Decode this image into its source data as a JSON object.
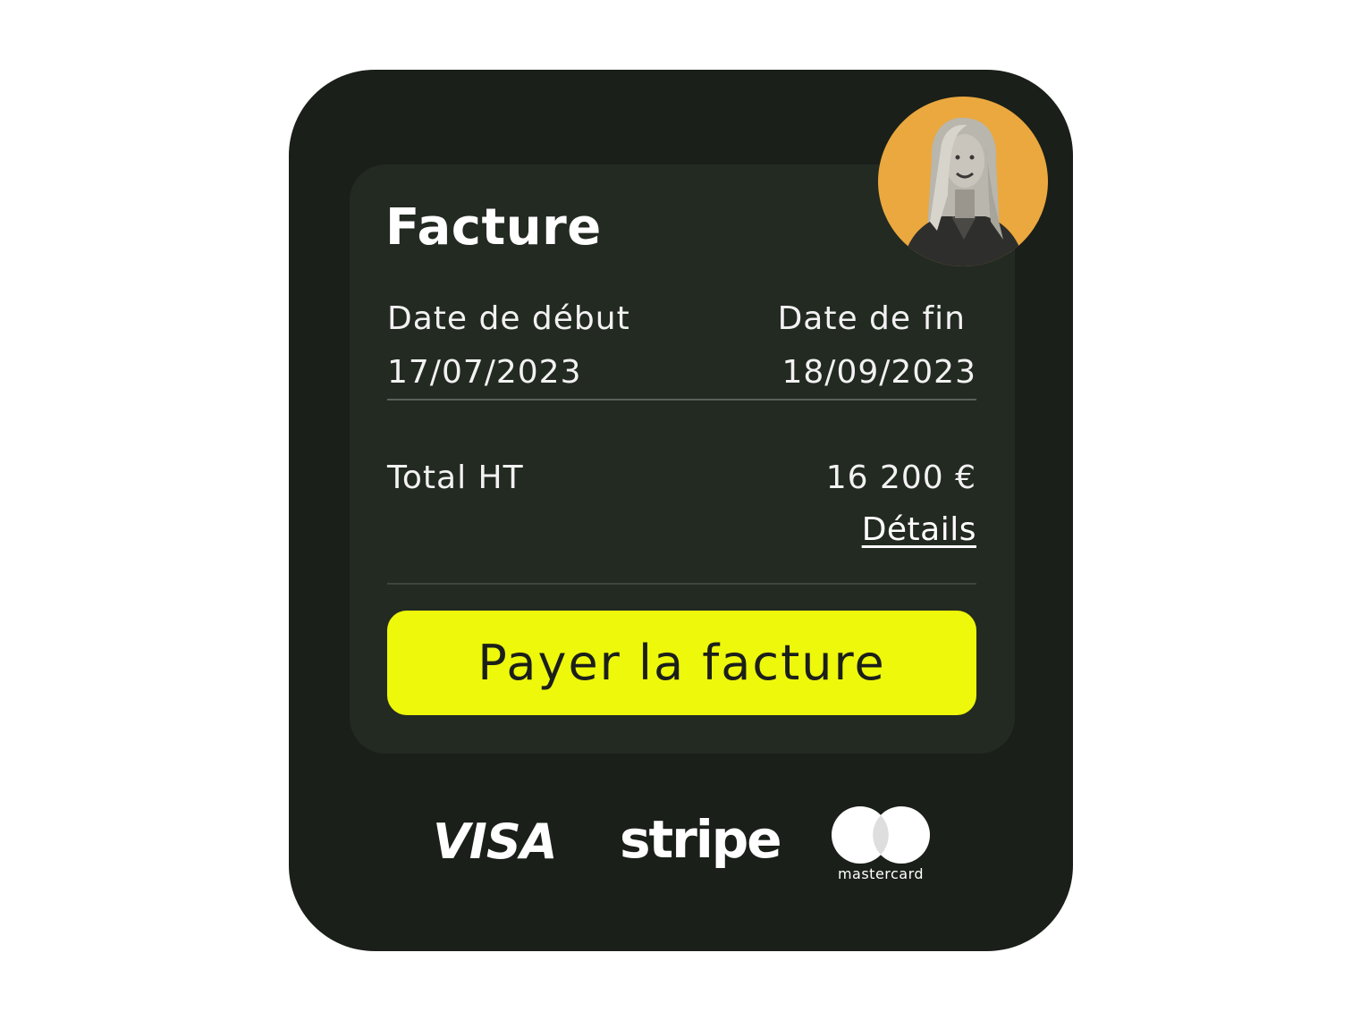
{
  "invoice": {
    "title": "Facture",
    "start_label": "Date de début",
    "start_value": "17/07/2023",
    "end_label": "Date de fin",
    "end_value": "18/09/2023",
    "total_label": "Total HT",
    "total_value": "16 200 €",
    "details_link": "Détails",
    "pay_button": "Payer la facture"
  },
  "payment_logos": {
    "visa": "VISA",
    "stripe": "stripe",
    "mastercard": "mastercard"
  },
  "colors": {
    "card_background": "#1a1f19",
    "panel_background": "#232a22",
    "accent_button": "#eef80a",
    "avatar_background": "#eaa83e"
  }
}
